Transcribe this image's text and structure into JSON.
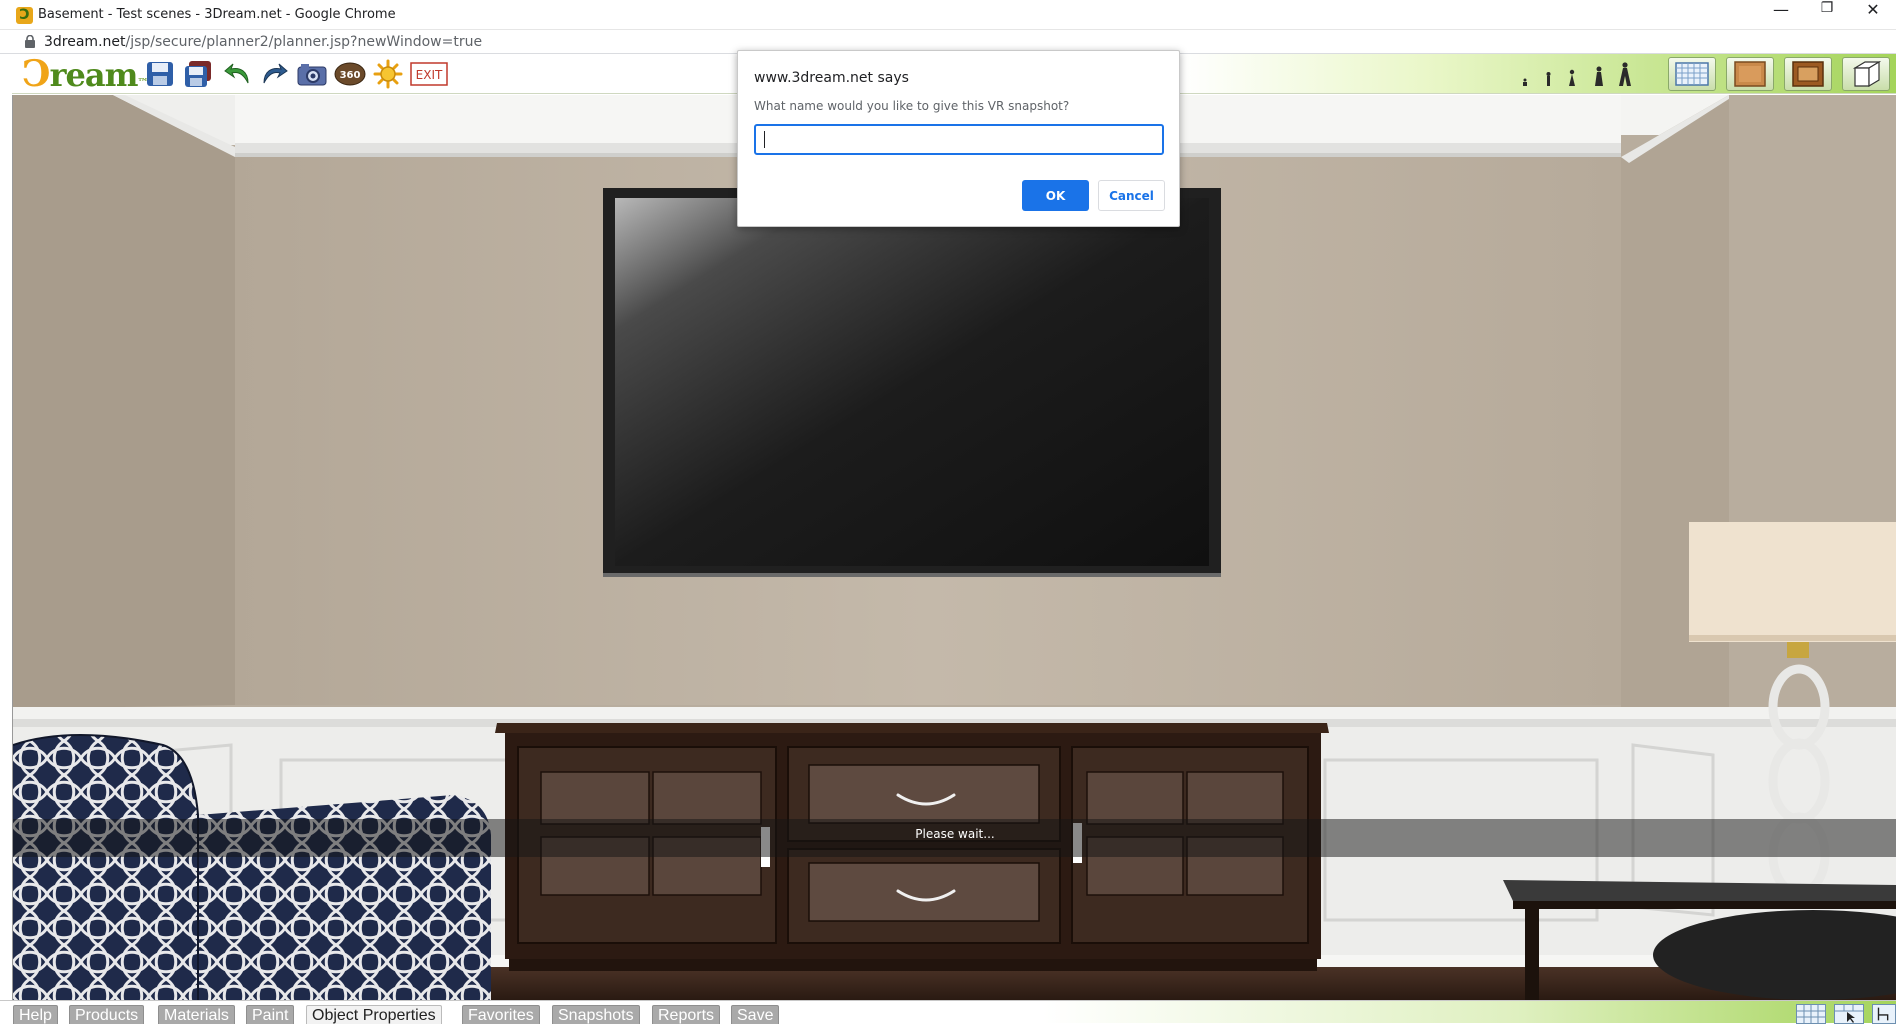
{
  "window": {
    "title": "Basement - Test scenes - 3Dream.net - Google Chrome",
    "favicon_glyph": "Ↄ",
    "minimize_glyph": "—",
    "restore_glyph": "❐",
    "close_glyph": "✕"
  },
  "address": {
    "domain": "3dream.net",
    "path": "/jsp/secure/planner2/planner.jsp?newWindow=true"
  },
  "app": {
    "logo_prefix": "Ↄ",
    "logo_name": "ream",
    "logo_suffix": "™",
    "toolbar_icons": [
      "save-icon",
      "save-as-icon",
      "undo-icon",
      "redo-icon",
      "camera-icon",
      "view-360-icon",
      "settings-sun-icon",
      "exit-icon"
    ],
    "exit_label": "EXIT",
    "view_360_label": "360",
    "view_buttons": [
      "floor-plan-view-icon",
      "wood-wall-view-icon",
      "framed-wall-view-icon",
      "3d-box-view-icon"
    ],
    "colors": {
      "brand_green": "#4f8a1c",
      "brand_orange": "#f0a418",
      "toolbar_gradient_end": "#a4d45a"
    }
  },
  "viewport": {
    "status_text": "Please wait..."
  },
  "tabs": [
    {
      "label": "Help",
      "active": false
    },
    {
      "label": "Products",
      "active": false
    },
    {
      "label": "Materials",
      "active": false
    },
    {
      "label": "Paint",
      "active": false
    },
    {
      "label": "Object Properties",
      "active": true
    },
    {
      "label": "Favorites",
      "active": false
    },
    {
      "label": "Snapshots",
      "active": false
    },
    {
      "label": "Reports",
      "active": false
    },
    {
      "label": "Save",
      "active": false
    }
  ],
  "dialog": {
    "origin": "www.3dream.net says",
    "message": "What name would you like to give this VR snapshot?",
    "input_value": "",
    "ok_label": "OK",
    "cancel_label": "Cancel",
    "colors": {
      "primary": "#1a73e8"
    }
  }
}
